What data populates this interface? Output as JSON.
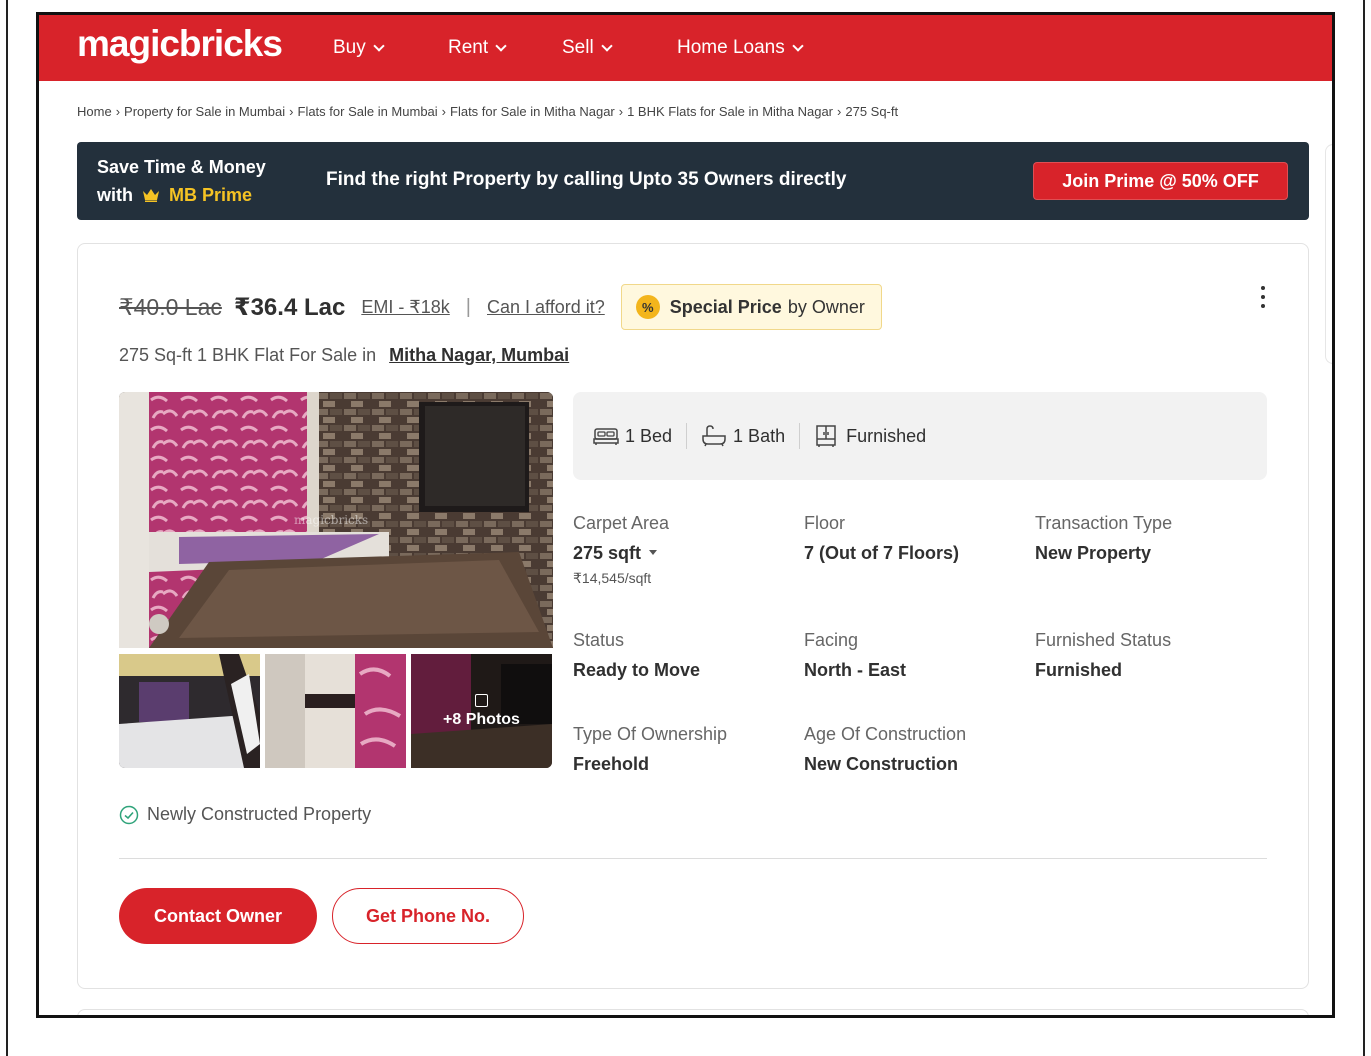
{
  "brand": {
    "logo_text": "magicbricks",
    "primary_color": "#d8232a"
  },
  "nav": {
    "items": [
      {
        "label": "Buy"
      },
      {
        "label": "Rent"
      },
      {
        "label": "Sell"
      },
      {
        "label": "Home Loans"
      }
    ]
  },
  "breadcrumb": [
    "Home",
    "Property for Sale in Mumbai",
    "Flats for Sale in Mumbai",
    "Flats for Sale in Mitha Nagar",
    "1 BHK Flats for Sale in Mitha Nagar",
    "275 Sq-ft"
  ],
  "breadcrumb_sep": "›",
  "prime": {
    "line1": "Save Time & Money",
    "line2_prefix": "with",
    "line2_brand": "MB Prime",
    "message": "Find the right Property by calling Upto 35 Owners directly",
    "cta": "Join Prime @ 50% OFF"
  },
  "listing": {
    "old_price": "₹40.0 Lac",
    "price": "₹36.4 Lac",
    "emi": "EMI - ₹18k",
    "separator": "|",
    "afford_link": "Can I afford it?",
    "special_icon": "%",
    "special_bold": "Special Price",
    "special_rest": "by Owner",
    "title_prefix": "275 Sq-ft 1 BHK Flat For Sale in",
    "location": "Mitha Nagar, Mumbai",
    "more_photos": "+8 Photos",
    "summary": {
      "bed": "1 Bed",
      "bath": "1 Bath",
      "furnishing": "Furnished"
    },
    "specs": {
      "carpet_area_label": "Carpet Area",
      "carpet_area_value": "275 sqft",
      "carpet_area_rate": "₹14,545/sqft",
      "floor_label": "Floor",
      "floor_value": "7 (Out of 7 Floors)",
      "transaction_label": "Transaction Type",
      "transaction_value": "New Property",
      "status_label": "Status",
      "status_value": "Ready to Move",
      "facing_label": "Facing",
      "facing_value": "North - East",
      "furnished_status_label": "Furnished Status",
      "furnished_status_value": "Furnished",
      "ownership_label": "Type Of Ownership",
      "ownership_value": "Freehold",
      "age_label": "Age Of Construction",
      "age_value": "New Construction"
    },
    "newly_constructed": "Newly Constructed Property",
    "contact_button": "Contact Owner",
    "phone_button": "Get Phone No."
  }
}
